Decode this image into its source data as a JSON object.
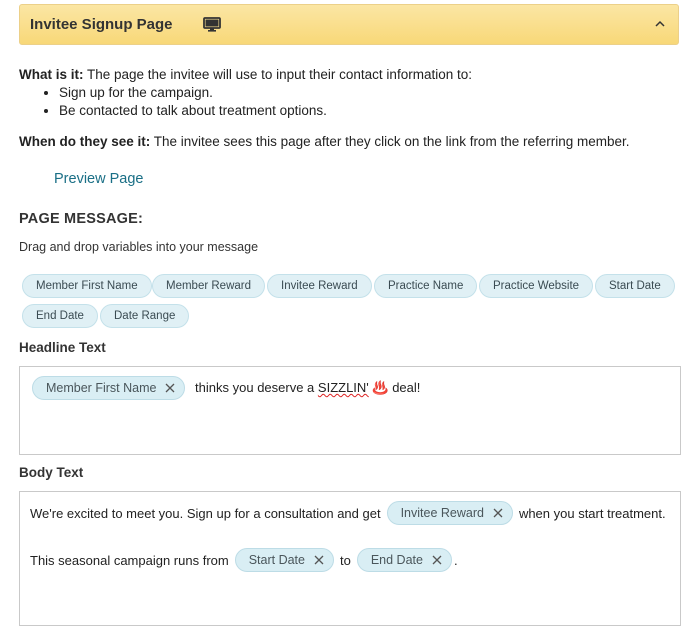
{
  "panel": {
    "title": "Invitee Signup Page",
    "icon": "monitor-icon",
    "collapse_icon": "chevron-up-icon"
  },
  "info": {
    "what_label": "What is it:",
    "what_text": " The page the invitee will use to input their contact information to:",
    "bullets": [
      "Sign up for the campaign.",
      "Be contacted to talk about treatment options."
    ],
    "when_label": "When do they see it:",
    "when_text": " The invitee sees this page after they click on the link from the referring member."
  },
  "preview_link": "Preview Page",
  "page_message": {
    "title": "PAGE MESSAGE:",
    "hint": "Drag and drop variables into your message",
    "variables": [
      "Member First Name",
      "Member Reward",
      "Invitee Reward",
      "Practice Name",
      "Practice Website",
      "Start Date",
      "End Date",
      "Date Range"
    ]
  },
  "headline": {
    "label": "Headline Text",
    "token": "Member First Name",
    "text_before_spell": " thinks you deserve a ",
    "spell_word": "SIZZLIN'",
    "text_after": " ♨️ deal!"
  },
  "body": {
    "label": "Body Text",
    "line1_pre": "We're excited to meet you. Sign up for a consultation and get",
    "line1_token": "Invitee Reward",
    "line1_post": "when you start treatment.",
    "line2_pre": "This seasonal campaign runs from",
    "line2_token1": "Start Date",
    "line2_mid": "to",
    "line2_token2": "End Date",
    "line2_post": "."
  },
  "colors": {
    "header_bg": "#f8d878",
    "chip_bg": "#e0f0f5",
    "link": "#1a6f86"
  }
}
